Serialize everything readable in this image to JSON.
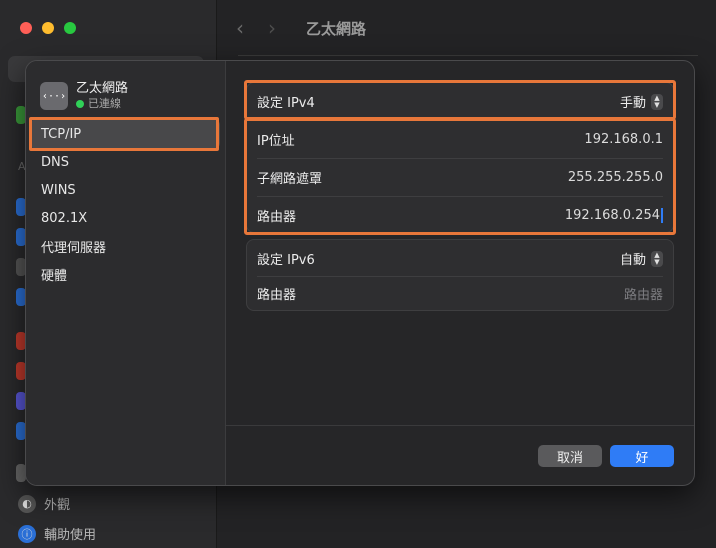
{
  "background": {
    "title": "乙太網路",
    "bottom_items": [
      {
        "label": "外觀",
        "icon": "appearance-icon"
      },
      {
        "label": "輔助使用",
        "icon": "accessibility-icon"
      }
    ]
  },
  "sheet": {
    "interface": {
      "name": "乙太網路",
      "status": "已連線",
      "icon": "ethernet-icon",
      "icon_glyph": "‹··›"
    },
    "nav": [
      "TCP/IP",
      "DNS",
      "WINS",
      "802.1X",
      "代理伺服器",
      "硬體"
    ],
    "ipv4": {
      "configure_label": "設定 IPv4",
      "configure_value": "手動",
      "ip_label": "IP位址",
      "ip_value": "192.168.0.1",
      "subnet_label": "子網路遮罩",
      "subnet_value": "255.255.255.0",
      "router_label": "路由器",
      "router_value": "192.168.0.254"
    },
    "ipv6": {
      "configure_label": "設定 IPv6",
      "configure_value": "自動",
      "router_label": "路由器",
      "router_placeholder": "路由器"
    },
    "buttons": {
      "cancel": "取消",
      "ok": "好"
    }
  },
  "colors": {
    "accent": "#2f7cf6",
    "highlight": "#e8773a",
    "connected": "#30d158"
  }
}
